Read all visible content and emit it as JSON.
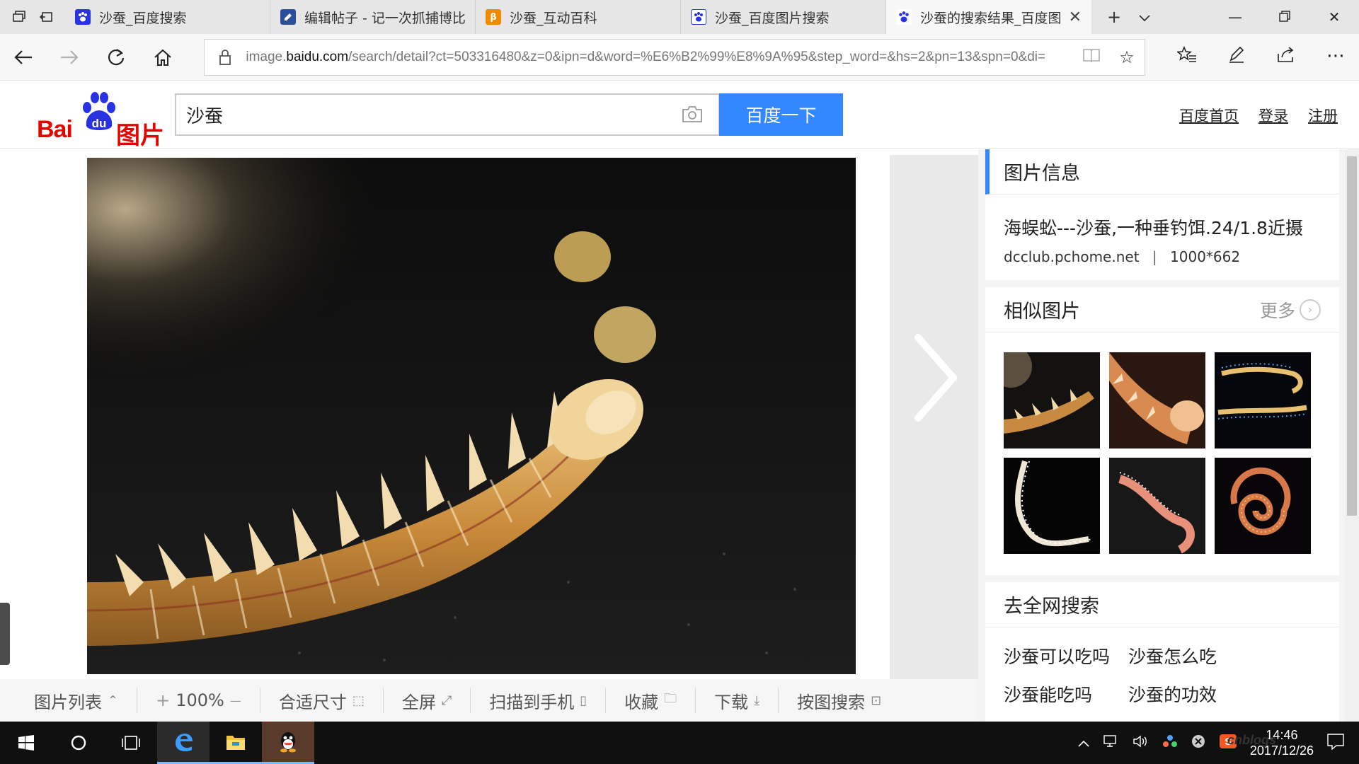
{
  "browser": {
    "tabs": [
      {
        "title": "沙蚕_百度搜索",
        "favicon_color": "#2932e1",
        "favicon_glyph": "paw"
      },
      {
        "title": "编辑帖子 - 记一次抓捕博比",
        "favicon_color": "#2a4f9c",
        "favicon_glyph": "edit"
      },
      {
        "title": "沙蚕_互动百科",
        "favicon_color": "#f08a00",
        "favicon_glyph": "β"
      },
      {
        "title": "沙蚕_百度图片搜索",
        "favicon_color": "#2932e1",
        "favicon_glyph": "paw"
      },
      {
        "title": "沙蚕的搜索结果_百度图",
        "favicon_color": "#2932e1",
        "favicon_glyph": "paw",
        "active": true
      }
    ],
    "url_prefix": "image.",
    "url_domain": "baidu.com",
    "url_rest": "/search/detail?ct=503316480&z=0&ipn=d&word=%E6%B2%99%E8%9A%95&step_word=&hs=2&pn=13&spn=0&di="
  },
  "header": {
    "logo_bai": "Bai",
    "logo_du": "du",
    "logo_tupian": "图片",
    "search_value": "沙蚕",
    "search_button": "百度一下",
    "links": [
      "百度首页",
      "登录",
      "注册"
    ]
  },
  "toolbar": {
    "image_list": "图片列表",
    "zoom_plus": "+",
    "zoom_level": "100%",
    "zoom_minus": "—",
    "fit_size": "合适尺寸",
    "fullscreen": "全屏",
    "scan_to_phone": "扫描到手机",
    "favorite": "收藏",
    "download": "下载",
    "search_by_image": "按图搜索"
  },
  "info_panel": {
    "title": "图片信息",
    "description": "海蜈蚣---沙蚕,一种垂钓饵.24/1.8近摄",
    "source": "dcclub.pchome.net",
    "separator": "|",
    "dimensions": "1000*662"
  },
  "similar": {
    "title": "相似图片",
    "more": "更多",
    "thumbnails": [
      "worm-closeup-dark",
      "worm-head-orange",
      "blue-worms",
      "white-worm-curve",
      "pink-worm",
      "spiral-worm"
    ]
  },
  "web_search": {
    "title": "去全网搜索",
    "links": [
      "沙蚕可以吃吗",
      "沙蚕怎么吃",
      "沙蚕能吃吗",
      "沙蚕的功效"
    ]
  },
  "taskbar": {
    "time": "14:46",
    "date": "2017/12/26",
    "watermark": "cnblogs"
  },
  "colors": {
    "baidu_red": "#e10601",
    "baidu_blue": "#3388ff",
    "accent_bar": "#3388ff"
  }
}
